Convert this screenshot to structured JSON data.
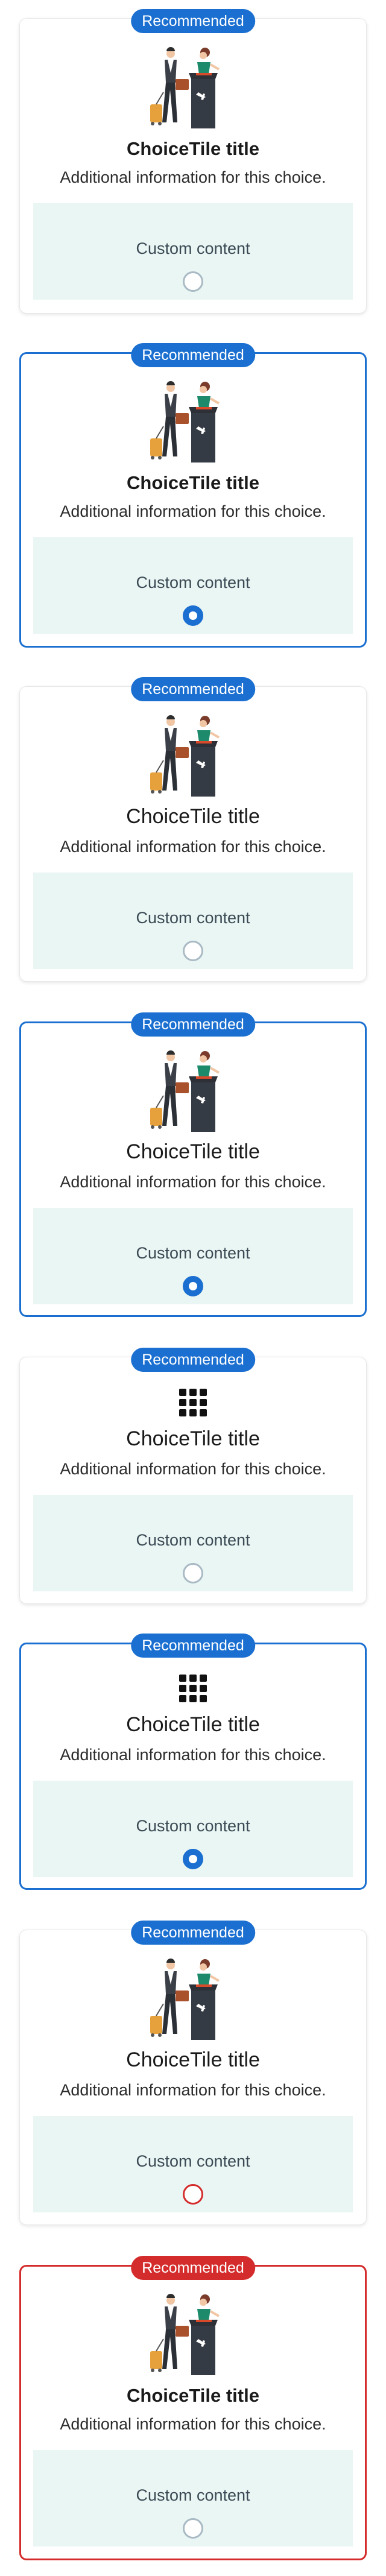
{
  "badge_label": "Recommended",
  "tile_title": "ChoiceTile title",
  "tile_description": "Additional information for this choice.",
  "custom_content_label": "Custom content",
  "tiles": [
    {
      "variant": "default",
      "media": "illustration",
      "title_style": "bold",
      "selected": false
    },
    {
      "variant": "selected",
      "media": "illustration",
      "title_style": "bold",
      "selected": true
    },
    {
      "variant": "default",
      "media": "illustration",
      "title_style": "regular",
      "selected": false
    },
    {
      "variant": "selected",
      "media": "illustration",
      "title_style": "regular",
      "selected": true
    },
    {
      "variant": "default",
      "media": "grid-icon",
      "title_style": "regular",
      "selected": false
    },
    {
      "variant": "selected",
      "media": "grid-icon",
      "title_style": "regular",
      "selected": true
    },
    {
      "variant": "error",
      "media": "illustration",
      "title_style": "regular",
      "selected": false
    },
    {
      "variant": "error",
      "media": "illustration",
      "title_style": "bold",
      "selected": false
    }
  ],
  "colors": {
    "accent": "#1a6fd0",
    "error": "#d42c2c",
    "custom_bg": "#eaf6f4",
    "radio_unselected": "#a9bac4"
  }
}
